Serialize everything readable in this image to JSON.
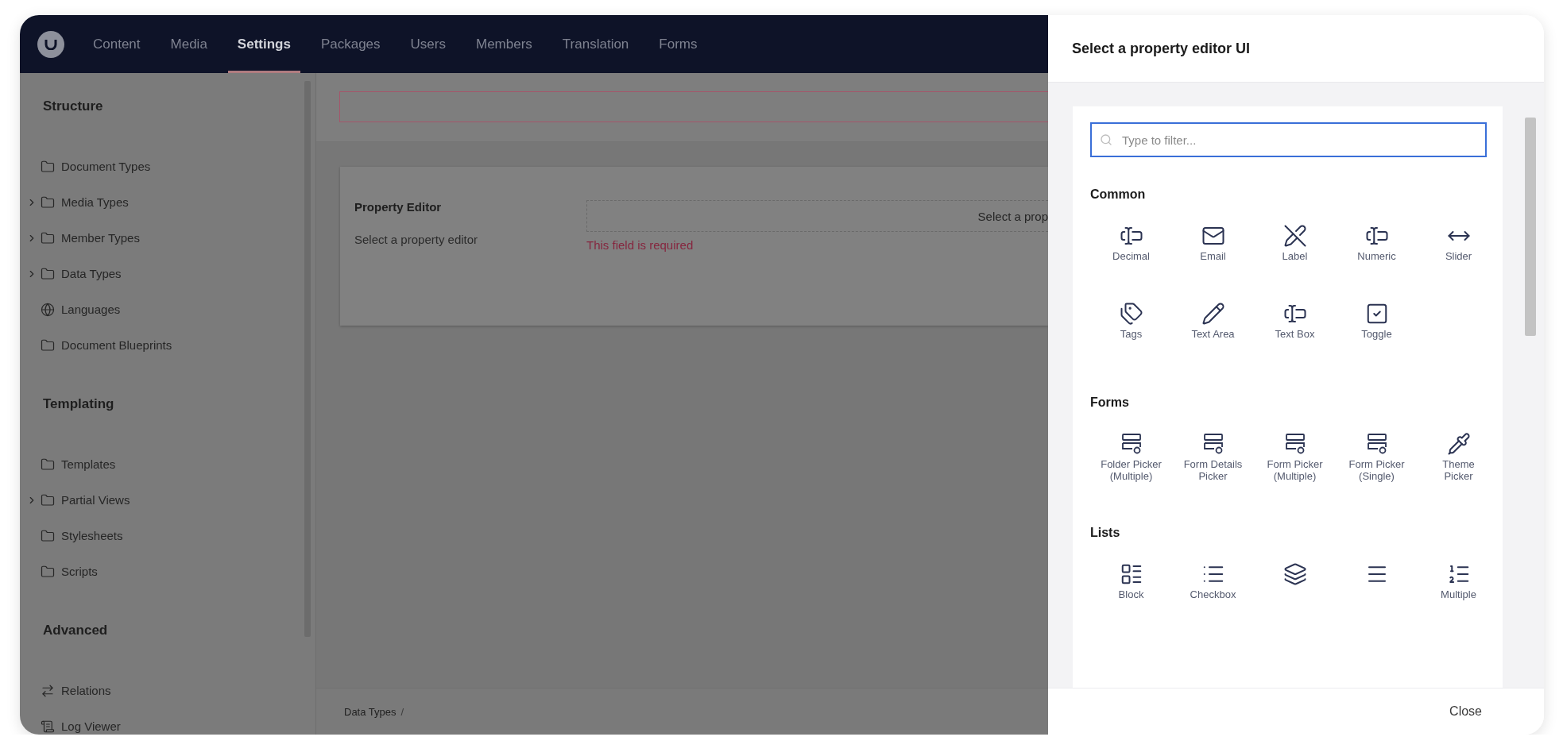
{
  "nav": {
    "items": [
      {
        "label": "Content",
        "selected": false
      },
      {
        "label": "Media",
        "selected": false
      },
      {
        "label": "Settings",
        "selected": true
      },
      {
        "label": "Packages",
        "selected": false
      },
      {
        "label": "Users",
        "selected": false
      },
      {
        "label": "Members",
        "selected": false
      },
      {
        "label": "Translation",
        "selected": false
      },
      {
        "label": "Forms",
        "selected": false
      }
    ]
  },
  "sidebar": {
    "sections": [
      {
        "title": "Structure",
        "items": [
          {
            "label": "Document Types",
            "kind": "folder",
            "has_children": false
          },
          {
            "label": "Media Types",
            "kind": "folder",
            "has_children": true
          },
          {
            "label": "Member Types",
            "kind": "folder",
            "has_children": true
          },
          {
            "label": "Data Types",
            "kind": "folder",
            "has_children": true
          },
          {
            "label": "Languages",
            "kind": "globe",
            "has_children": false
          },
          {
            "label": "Document Blueprints",
            "kind": "folder",
            "has_children": false
          }
        ]
      },
      {
        "title": "Templating",
        "items": [
          {
            "label": "Templates",
            "kind": "folder",
            "has_children": false
          },
          {
            "label": "Partial Views",
            "kind": "folder",
            "has_children": true
          },
          {
            "label": "Stylesheets",
            "kind": "folder",
            "has_children": false
          },
          {
            "label": "Scripts",
            "kind": "folder",
            "has_children": false
          }
        ]
      },
      {
        "title": "Advanced",
        "items": [
          {
            "label": "Relations",
            "kind": "relations",
            "has_children": false
          },
          {
            "label": "Log Viewer",
            "kind": "log",
            "has_children": false
          }
        ]
      }
    ]
  },
  "editor": {
    "property": {
      "label": "Property Editor",
      "description": "Select a property editor",
      "value": "Select a prop",
      "error": "This field is required"
    },
    "breadcrumb": [
      "Data Types",
      "/"
    ]
  },
  "panel": {
    "title": "Select a property editor UI",
    "filter": {
      "placeholder": "Type to filter..."
    },
    "groups": [
      {
        "title": "Common",
        "items": [
          {
            "label": "Decimal",
            "kind": "text-cursor"
          },
          {
            "label": "Email",
            "kind": "mail"
          },
          {
            "label": "Label",
            "kind": "pen-off"
          },
          {
            "label": "Numeric",
            "kind": "text-cursor"
          },
          {
            "label": "Slider",
            "kind": "arrows"
          },
          {
            "label": "Tags",
            "kind": "tags"
          },
          {
            "label": "Text Area",
            "kind": "pencil"
          },
          {
            "label": "Text Box",
            "kind": "text-cursor"
          },
          {
            "label": "Toggle",
            "kind": "checkbox"
          }
        ]
      },
      {
        "title": "Forms",
        "items": [
          {
            "label": "Folder Picker (Multiple)",
            "kind": "form"
          },
          {
            "label": "Form Details Picker",
            "kind": "form"
          },
          {
            "label": "Form Picker (Multiple)",
            "kind": "form"
          },
          {
            "label": "Form Picker (Single)",
            "kind": "form"
          },
          {
            "label": "Theme Picker",
            "kind": "pipette"
          }
        ]
      },
      {
        "title": "Lists",
        "items": [
          {
            "label": "Block",
            "kind": "block-list"
          },
          {
            "label": "Checkbox",
            "kind": "list"
          },
          {
            "kind": "layers"
          },
          {
            "kind": "menu"
          },
          {
            "label": "Multiple",
            "kind": "numbered-list"
          }
        ]
      }
    ],
    "close": "Close"
  }
}
